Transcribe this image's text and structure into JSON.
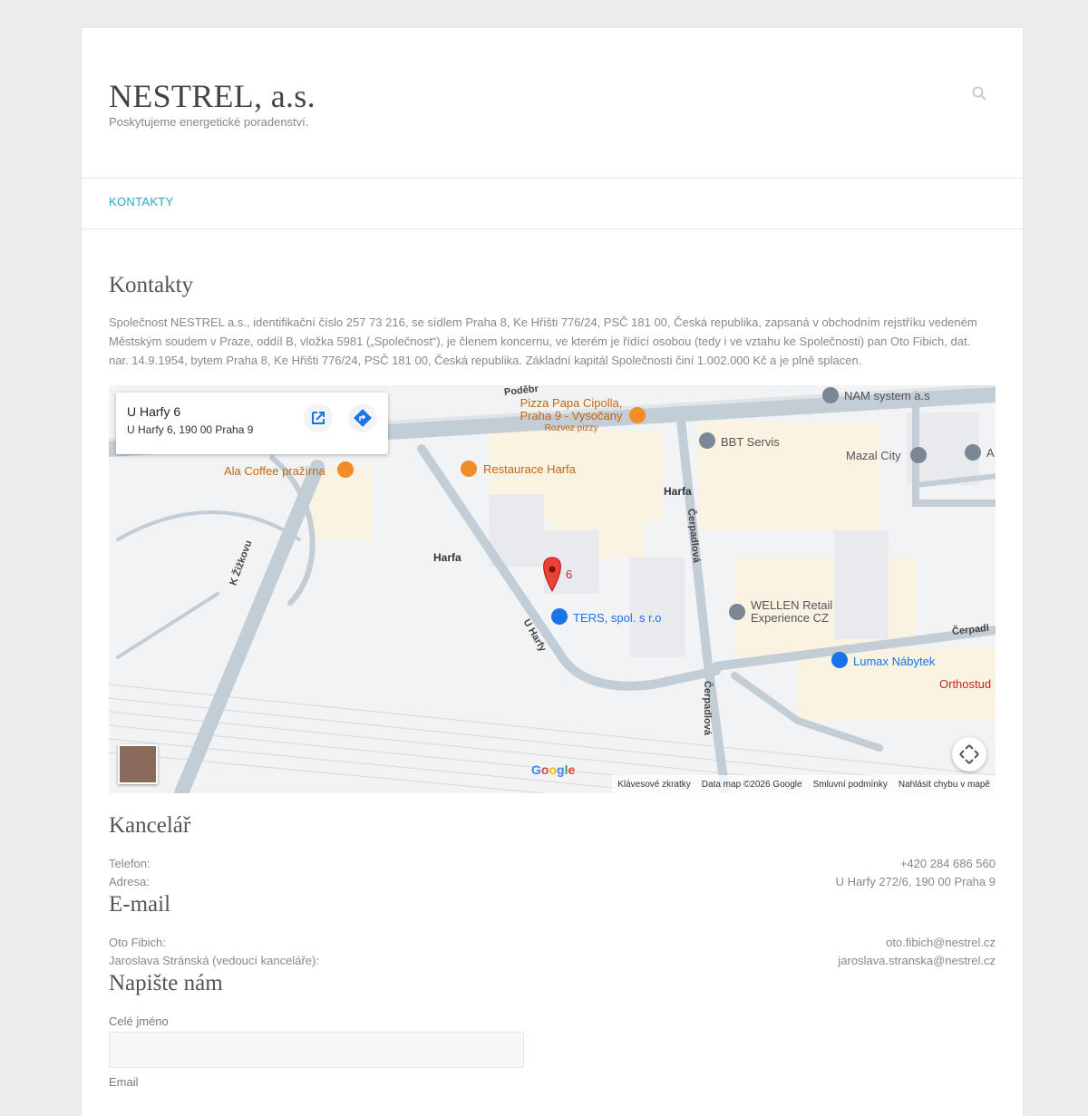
{
  "site": {
    "title": "NESTREL, a.s.",
    "tagline": "Poskytujeme energetické poradenství."
  },
  "nav": {
    "items": [
      {
        "label": "KONTAKTY"
      }
    ]
  },
  "kontakty": {
    "heading": "Kontakty",
    "intro": "Společnost NESTREL a.s., identifikační číslo 257 73 216, se sídlem Praha 8, Ke Hřišti 776/24, PSČ 181 00, Česká republika, zapsaná v obchodním rejstříku vedeném Městským soudem v Praze, oddíl B, vložka 5981 („Společnost“), je členem koncernu, ve kterém je řídící osobou (tedy i ve vztahu ke Společnosti) pan Oto Fibich, dat. nar. 14.9.1954, bytem Praha 8, Ke Hřišti 776/24, PSČ 181 00, Česká republika. Základní kapitál Společnosti činí 1.002.000 Kč a je plně splacen."
  },
  "map": {
    "card_title": "U Harfy 6",
    "card_address": "U Harfy 6, 190 00 Praha 9",
    "marker_label": "6",
    "places": {
      "pizza": "Pizza Papa Cipolla, Praha 9 - Vysočany",
      "pizza_sub": "Rozvoz pizzy",
      "nam": "NAM system a.s",
      "bbt": "BBT Servis",
      "mazal": "Mazal City",
      "a": "A",
      "coffee": "Ala Coffee pražírna",
      "restaurace": "Restaurace Harfa",
      "harfa1": "Harfa",
      "harfa2": "Harfa",
      "ters": "TERS, spol. s r.o",
      "wellen": "WELLEN Retail Experience CZ",
      "lumax": "Lumax Nábytek",
      "orthostud": "Orthostud"
    },
    "streets": {
      "zizkovu": "K Žižkovu",
      "uharfy": "U Harfy",
      "cerpadlova1": "Čerpadlová",
      "cerpadlova2": "Čerpadlová",
      "cerpadl": "Čerpadl",
      "podebr": "Poděbr"
    },
    "footer": {
      "shortcuts": "Klávesové zkratky",
      "data": "Data map ©2026 Google",
      "terms": "Smluvní podmínky",
      "report": "Nahlásit chybu v mapě"
    },
    "google": "Google"
  },
  "kancelar": {
    "heading": "Kancelář",
    "rows": [
      {
        "key": "Telefon:",
        "value": "+420 284 686 560"
      },
      {
        "key": "Adresa:",
        "value": "U Harfy 272/6, 190 00 Praha 9"
      }
    ]
  },
  "email": {
    "heading": "E-mail",
    "rows": [
      {
        "key": "Oto Fibich:",
        "value": "oto.fibich@nestrel.cz"
      },
      {
        "key": "Jaroslava Stránská (vedoucí kanceláře):",
        "value": "jaroslava.stranska@nestrel.cz"
      }
    ]
  },
  "form": {
    "heading": "Napište nám",
    "name_label": "Celé jméno",
    "email_label": "Email"
  }
}
